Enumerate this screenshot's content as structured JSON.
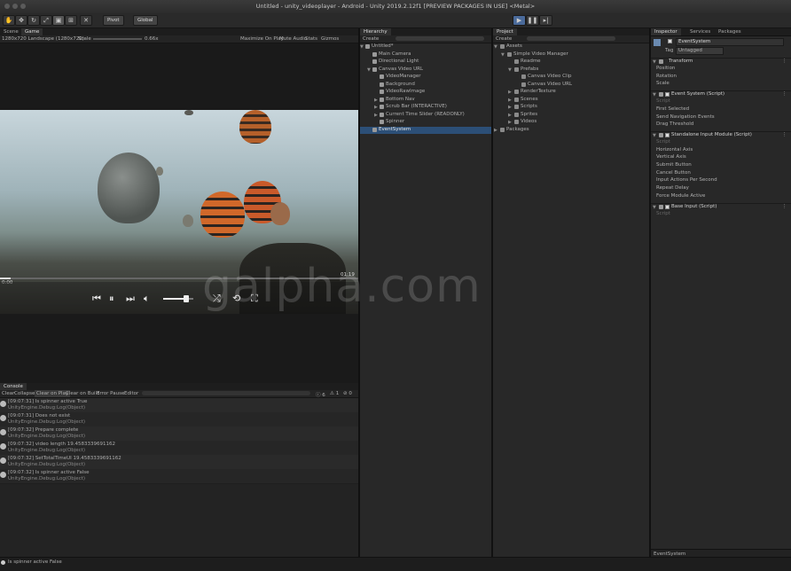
{
  "window": {
    "title": "Untitled - unity_videoplayer - Android - Unity 2019.2.12f1 [PREVIEW PACKAGES IN USE] <Metal>"
  },
  "toolbar": {
    "pivot_label": "Pivot",
    "global_label": "Global"
  },
  "scene_tabs": {
    "scene": "Scene",
    "game": "Game"
  },
  "game_view": {
    "resolution": "1280x720 Landscape (1280x720)",
    "scale_label": "Scale",
    "scale_value": "0.66x",
    "options": [
      "Maximize On Play",
      "Mute Audio",
      "Stats",
      "Gizmos"
    ]
  },
  "video_player": {
    "time_start": "0:00",
    "time_end": "01:19",
    "volume": 0.75,
    "progress": 0.03
  },
  "watermark": "galpha.com",
  "hierarchy": {
    "tab": "Hierarchy",
    "create_label": "Create",
    "items": [
      {
        "label": "Untitled*",
        "level": 0,
        "arrow": "▼",
        "icon": "unity-icon",
        "selected": false
      },
      {
        "label": "Main Camera",
        "level": 1,
        "arrow": "",
        "icon": "cube-icon",
        "selected": false
      },
      {
        "label": "Directional Light",
        "level": 1,
        "arrow": "",
        "icon": "cube-icon",
        "selected": false
      },
      {
        "label": "Canvas Video URL",
        "level": 1,
        "arrow": "▼",
        "icon": "cube-icon",
        "selected": false
      },
      {
        "label": "VideoManager",
        "level": 2,
        "arrow": "",
        "icon": "cube-icon",
        "selected": false
      },
      {
        "label": "Background",
        "level": 2,
        "arrow": "",
        "icon": "cube-icon",
        "selected": false
      },
      {
        "label": "VideoRawImage",
        "level": 2,
        "arrow": "",
        "icon": "cube-icon",
        "selected": false
      },
      {
        "label": "Bottom Nav",
        "level": 2,
        "arrow": "▶",
        "icon": "cube-icon",
        "selected": false
      },
      {
        "label": "Scrub Bar (INTERACTIVE)",
        "level": 2,
        "arrow": "▶",
        "icon": "cube-icon",
        "selected": false
      },
      {
        "label": "Current Time Slider (READONLY)",
        "level": 2,
        "arrow": "▶",
        "icon": "cube-icon",
        "selected": false
      },
      {
        "label": "Spinner",
        "level": 2,
        "arrow": "",
        "icon": "cube-icon",
        "selected": false
      },
      {
        "label": "EventSystem",
        "level": 1,
        "arrow": "",
        "icon": "cube-icon",
        "selected": true
      }
    ]
  },
  "project": {
    "tab": "Project",
    "create_label": "Create",
    "items": [
      {
        "label": "Assets",
        "level": 0,
        "arrow": "▼",
        "icon": "folder-icon"
      },
      {
        "label": "Simple Video Manager",
        "level": 1,
        "arrow": "▼",
        "icon": "folder-icon"
      },
      {
        "label": "Readme",
        "level": 2,
        "arrow": "",
        "icon": "file-icon"
      },
      {
        "label": "Prefabs",
        "level": 2,
        "arrow": "▼",
        "icon": "folder-icon"
      },
      {
        "label": "Canvas Video Clip",
        "level": 3,
        "arrow": "",
        "icon": "prefab-icon"
      },
      {
        "label": "Canvas Video URL",
        "level": 3,
        "arrow": "",
        "icon": "prefab-icon"
      },
      {
        "label": "RenderTexture",
        "level": 2,
        "arrow": "▶",
        "icon": "folder-icon"
      },
      {
        "label": "Scenes",
        "level": 2,
        "arrow": "▶",
        "icon": "folder-icon"
      },
      {
        "label": "Scripts",
        "level": 2,
        "arrow": "▶",
        "icon": "folder-icon"
      },
      {
        "label": "Sprites",
        "level": 2,
        "arrow": "▶",
        "icon": "folder-icon"
      },
      {
        "label": "Videos",
        "level": 2,
        "arrow": "▶",
        "icon": "folder-icon"
      },
      {
        "label": "Packages",
        "level": 0,
        "arrow": "▶",
        "icon": "folder-icon"
      }
    ]
  },
  "inspector": {
    "tabs": [
      "Inspector",
      "Services",
      "Packages"
    ],
    "object_name": "EventSystem",
    "tag_label": "Tag",
    "tag_value": "Untagged",
    "rows": [
      {
        "label": "Transform",
        "kind": "component"
      },
      {
        "label": "Position",
        "kind": "field"
      },
      {
        "label": "Rotation",
        "kind": "field"
      },
      {
        "label": "Scale",
        "kind": "field"
      },
      {
        "label": "Event System (Script)",
        "kind": "component"
      },
      {
        "label": "Script",
        "kind": "field-dim"
      },
      {
        "label": "First Selected",
        "kind": "field"
      },
      {
        "label": "Send Navigation Events",
        "kind": "field"
      },
      {
        "label": "Drag Threshold",
        "kind": "field"
      },
      {
        "label": "Standalone Input Module (Script)",
        "kind": "component"
      },
      {
        "label": "Script",
        "kind": "field-dim"
      },
      {
        "label": "Horizontal Axis",
        "kind": "field"
      },
      {
        "label": "Vertical Axis",
        "kind": "field"
      },
      {
        "label": "Submit Button",
        "kind": "field"
      },
      {
        "label": "Cancel Button",
        "kind": "field"
      },
      {
        "label": "Input Actions Per Second",
        "kind": "field"
      },
      {
        "label": "Repeat Delay",
        "kind": "field"
      },
      {
        "label": "Force Module Active",
        "kind": "field"
      },
      {
        "label": "Base Input (Script)",
        "kind": "component"
      },
      {
        "label": "Script",
        "kind": "field-dim"
      }
    ],
    "footer": "EventSystem"
  },
  "console": {
    "tab": "Console",
    "buttons": [
      "Clear",
      "Collapse",
      "Clear on Play",
      "Clear on Build",
      "Error Pause",
      "Editor"
    ],
    "counts": {
      "log": "6",
      "warn": "1",
      "error": "0"
    },
    "entries": [
      {
        "line1": "[09:07:31] Is spinner active True",
        "line2": "UnityEngine.Debug:Log(Object)"
      },
      {
        "line1": "[09:07:31] Does not exist",
        "line2": "UnityEngine.Debug:Log(Object)"
      },
      {
        "line1": "[09:07:32] Prepare complete",
        "line2": "UnityEngine.Debug:Log(Object)"
      },
      {
        "line1": "[09:07:32] video length 19.4583339691162",
        "line2": "UnityEngine.Debug:Log(Object)"
      },
      {
        "line1": "[09:07:32] SetTotalTimeUI 19.4583339691162",
        "line2": "UnityEngine.Debug:Log(Object)"
      },
      {
        "line1": "[09:07:32] Is spinner active False",
        "line2": "UnityEngine.Debug:Log(Object)"
      }
    ]
  },
  "status_bar": {
    "message": "Is spinner active False"
  }
}
